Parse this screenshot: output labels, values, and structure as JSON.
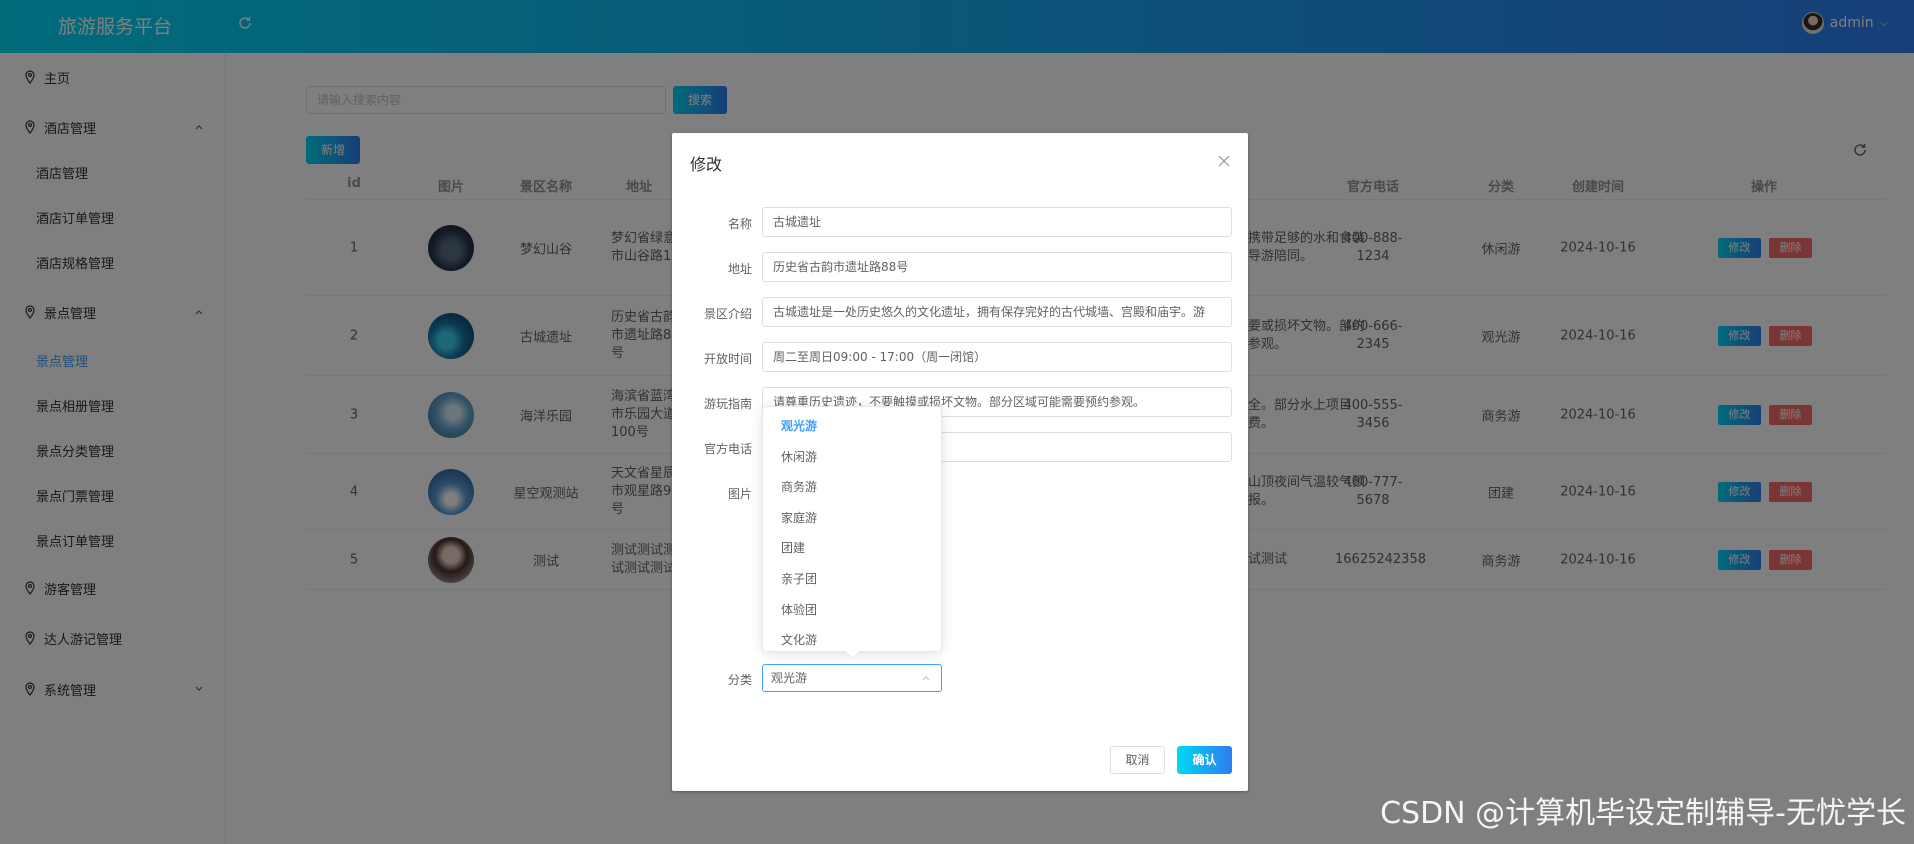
{
  "header": {
    "brand": "旅游服务平台",
    "user": "admin",
    "user_caret": "⌵",
    "refresh_icon": "refresh-icon"
  },
  "sidebar": {
    "items": [
      {
        "label": "主页",
        "icon": "location-icon"
      },
      {
        "label": "酒店管理",
        "icon": "location-icon",
        "expanded": true,
        "children": [
          "酒店管理",
          "酒店订单管理",
          "酒店规格管理"
        ]
      },
      {
        "label": "景点管理",
        "icon": "location-icon",
        "expanded": true,
        "children": [
          "景点管理",
          "景点相册管理",
          "景点分类管理",
          "景点门票管理",
          "景点订单管理"
        ]
      },
      {
        "label": "游客管理",
        "icon": "location-icon"
      },
      {
        "label": "达人游记管理",
        "icon": "location-icon"
      },
      {
        "label": "系统管理",
        "icon": "location-icon",
        "expanded": false
      }
    ],
    "active": "景点管理"
  },
  "toolbar": {
    "search_placeholder": "请输入搜索内容",
    "search_label": "搜索",
    "add_label": "新增"
  },
  "table": {
    "columns": [
      "id",
      "图片",
      "景区名称",
      "地址",
      "官方电话",
      "分类",
      "创建时间",
      "操作"
    ],
    "rows": [
      {
        "id": "1",
        "name": "梦幻山谷",
        "address": "梦幻省绿意市山谷路1号",
        "desc": "携带足够的水和食装导游陪同。",
        "phone": "400-888-1234",
        "category": "休闲游",
        "created": "2024-10-16"
      },
      {
        "id": "2",
        "name": "古城遗址",
        "address": "历史省古韵市遗址路88号",
        "desc": "要或损坏文物。部约参观。",
        "phone": "400-666-2345",
        "category": "观光游",
        "created": "2024-10-16"
      },
      {
        "id": "3",
        "name": "海洋乐园",
        "address": "海滨省蓝湾市乐园大道100号",
        "desc": "全。部分水上项目费。",
        "phone": "400-555-3456",
        "category": "商务游",
        "created": "2024-10-16"
      },
      {
        "id": "4",
        "name": "星空观测站",
        "address": "天文省星辰市观星路99号",
        "desc": "山顶夜间气温较气预报。",
        "phone": "400-777-5678",
        "category": "团建",
        "created": "2024-10-16"
      },
      {
        "id": "5",
        "name": "测试",
        "address": "测试测试测试测试测试",
        "desc": "试测试",
        "phone": "16625242358",
        "category": "商务游",
        "created": "2024-10-16"
      }
    ],
    "edit_label": "修改",
    "delete_label": "删除"
  },
  "dialog": {
    "title": "修改",
    "fields": {
      "name": {
        "label": "名称",
        "value": "古城遗址"
      },
      "address": {
        "label": "地址",
        "value": "历史省古韵市遗址路88号"
      },
      "intro": {
        "label": "景区介绍",
        "value": "古城遗址是一处历史悠久的文化遗址，拥有保存完好的古代城墙、宫殿和庙宇。游"
      },
      "hours": {
        "label": "开放时间",
        "value": "周二至周日09:00 - 17:00（周一闭馆）"
      },
      "guide": {
        "label": "游玩指南",
        "value": "请尊重历史遗迹，不要触摸或损坏文物。部分区域可能需要预约参观。"
      },
      "phone": {
        "label": "官方电话",
        "value": ""
      },
      "image": {
        "label": "图片"
      },
      "category": {
        "label": "分类",
        "value": "观光游"
      }
    },
    "category_options": [
      "观光游",
      "休闲游",
      "商务游",
      "家庭游",
      "团建",
      "亲子团",
      "体验团",
      "文化游"
    ],
    "cancel_label": "取消",
    "confirm_label": "确认"
  },
  "watermark": "CSDN @计算机毕设定制辅导-无忧学长",
  "colors": {
    "accent_start": "#00d8f5",
    "accent_end": "#2f7df0",
    "danger": "#f56c6c",
    "active_link": "#409eff"
  }
}
